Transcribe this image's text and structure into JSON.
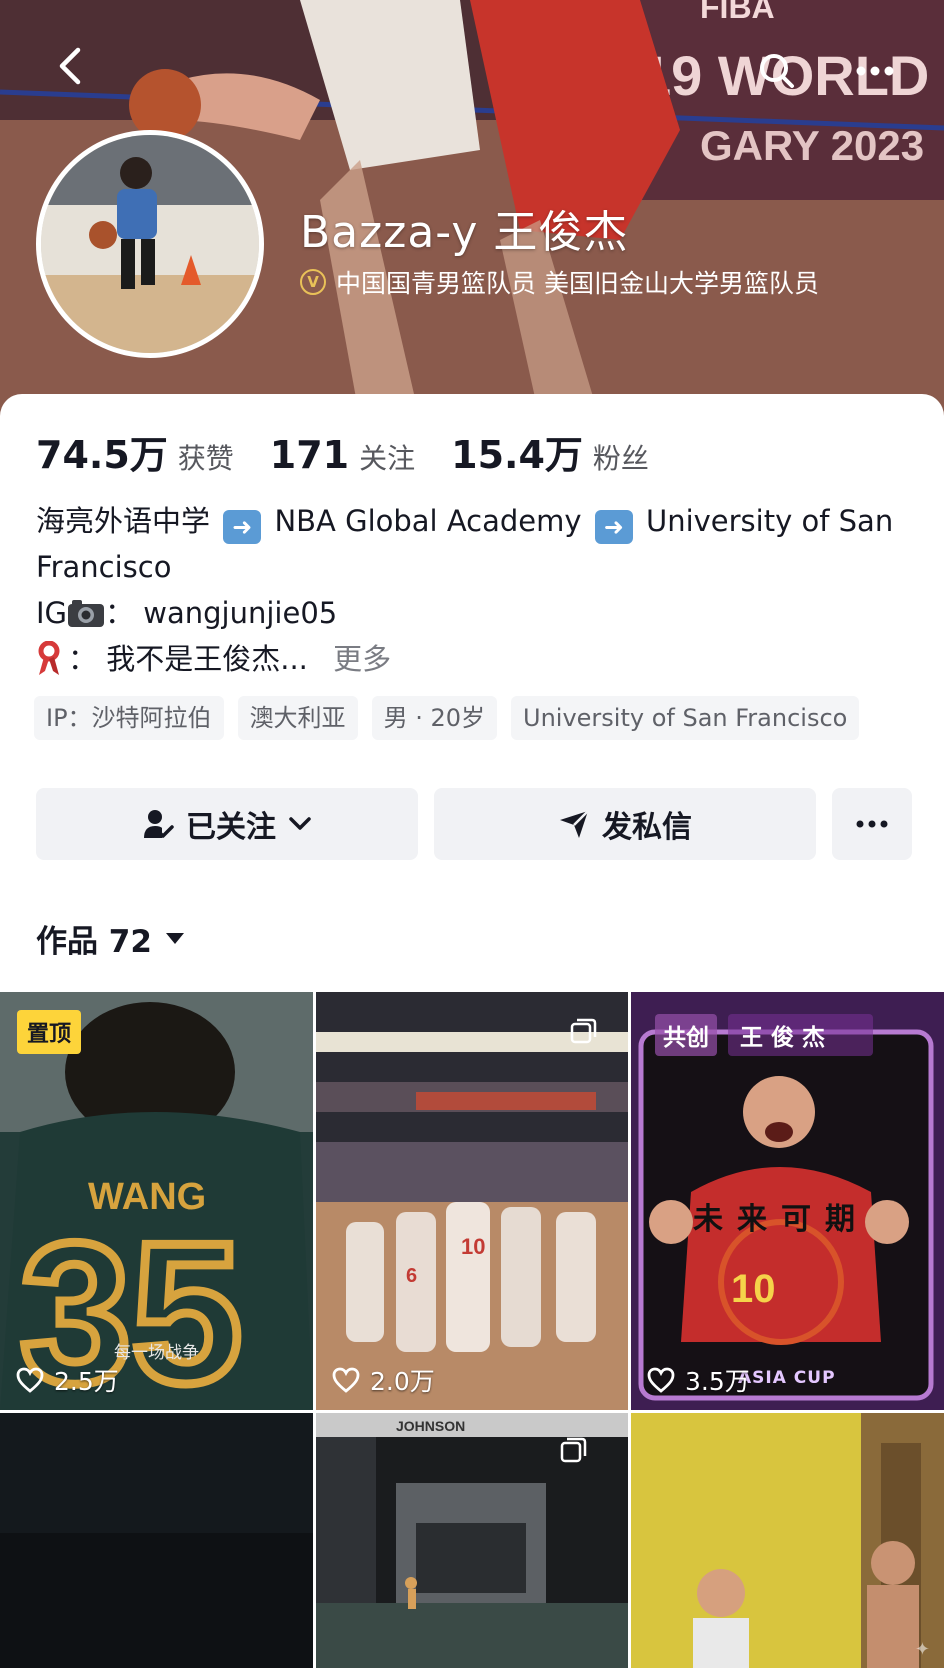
{
  "profile": {
    "display_name": "Bazza-y 王俊杰",
    "verification": "中国国青男篮队员 美国旧金山大学男篮队员"
  },
  "stats": {
    "likes_value": "74.5万",
    "likes_label": "获赞",
    "following_value": "171",
    "following_label": "关注",
    "followers_value": "15.4万",
    "followers_label": "粉丝"
  },
  "bio": {
    "school_1": "海亮外语中学",
    "school_2": "NBA Global Academy",
    "school_3": "University of San Francisco",
    "ig_prefix": "IG",
    "ig_separator": "：",
    "ig_handle": "wangjunjie05",
    "line_separator": "：",
    "line_text": "我不是王俊杰...",
    "more_label": "更多"
  },
  "tags": [
    "IP：沙特阿拉伯",
    "澳大利亚",
    "男 · 20岁",
    "University of San Francisco"
  ],
  "actions": {
    "follow_label": "已关注",
    "message_label": "发私信"
  },
  "works": {
    "label": "作品 72"
  },
  "grid": {
    "tile_1": {
      "pin_label": "置顶",
      "likes": "2.5万",
      "caption": "每一场战争",
      "jersey_text": "WANG",
      "jersey_number": "35"
    },
    "tile_2": {
      "likes": "2.0万"
    },
    "tile_3": {
      "co_label": "共创",
      "co_name": "王俊杰",
      "likes": "3.5万",
      "slogan": "未来可期",
      "event": "ASIA CUP"
    },
    "tile_5": {
      "sign_text": "JOHNSON"
    }
  },
  "colors": {
    "accent_gold": "#fdd43a",
    "verify_gold": "#e9c158",
    "text_primary": "#161823",
    "text_secondary": "#57585e"
  },
  "icons": [
    "back-arrow-icon",
    "search-icon",
    "more-dots-icon",
    "verified-badge-icon",
    "follow-check-icon",
    "chevron-down-icon",
    "send-icon",
    "heart-icon",
    "camera-icon",
    "ribbon-icon"
  ]
}
